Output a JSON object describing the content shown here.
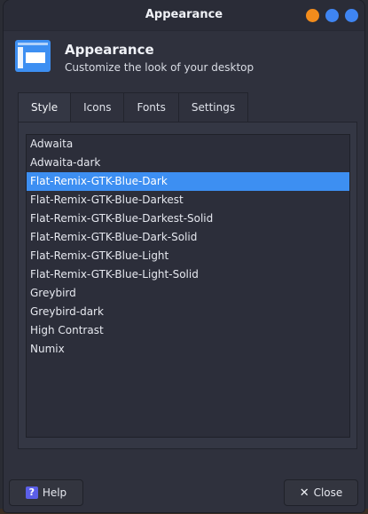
{
  "window": {
    "title": "Appearance"
  },
  "header": {
    "title": "Appearance",
    "subtitle": "Customize the look of your desktop"
  },
  "tabs": [
    {
      "label": "Style",
      "active": true
    },
    {
      "label": "Icons",
      "active": false
    },
    {
      "label": "Fonts",
      "active": false
    },
    {
      "label": "Settings",
      "active": false
    }
  ],
  "themes": {
    "selected": "Flat-Remix-GTK-Blue-Dark",
    "items": [
      "Adwaita",
      "Adwaita-dark",
      "Flat-Remix-GTK-Blue-Dark",
      "Flat-Remix-GTK-Blue-Darkest",
      "Flat-Remix-GTK-Blue-Darkest-Solid",
      "Flat-Remix-GTK-Blue-Dark-Solid",
      "Flat-Remix-GTK-Blue-Light",
      "Flat-Remix-GTK-Blue-Light-Solid",
      "Greybird",
      "Greybird-dark",
      "High Contrast",
      "Numix"
    ]
  },
  "footer": {
    "help_label": "Help",
    "close_label": "Close"
  },
  "colors": {
    "accent": "#3d8ff2",
    "minimize": "#f28c1c",
    "maximize": "#3f85f2",
    "close": "#3f85f2"
  },
  "icons": {
    "app": "appearance-preferences-icon",
    "help": "help-icon",
    "close": "close-icon"
  }
}
